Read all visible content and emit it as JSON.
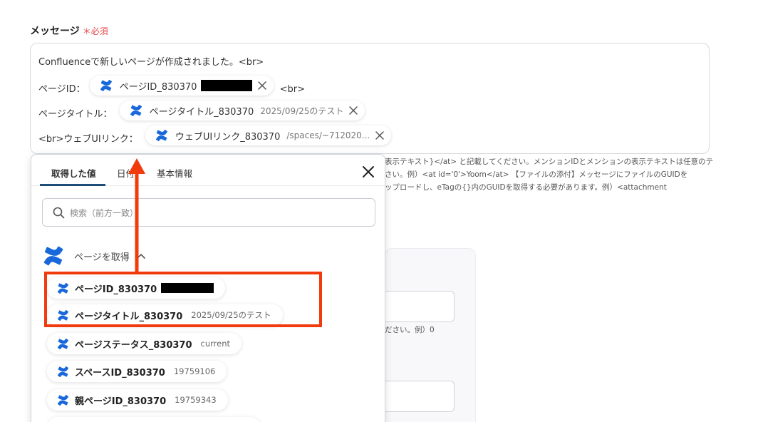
{
  "field": {
    "label": "メッセージ",
    "required_mark": "＊",
    "required_text": "必須"
  },
  "message": {
    "line1": "Confluenceで新しいページが作成されました。<br>",
    "line2_prefix": "ページID：",
    "line2_pill": "ページID_830370",
    "line2_suffix": "<br>",
    "line3_prefix": "ページタイトル：",
    "line3_pill": "ページタイトル_830370",
    "line3_pill_value": "2025/09/25のテスト",
    "line4_prefix": "<br>ウェブUIリンク：",
    "line4_pill": "ウェブUIリンク_830370",
    "line4_pill_value": "/spaces/~712020..."
  },
  "help_text": [
    "表示テキスト}</at> と記載してください。メンションIDとメンションの表示テキストは任意のテ",
    "さい。例）<at id='0'>Yoom</at>  【ファイルの添付】メッセージにファイルのGUIDを",
    "ップロードし、eTagの{}内のGUIDを取得する必要があります。例）<attachment"
  ],
  "bg_snippet": "ださい。例）0",
  "popup": {
    "tabs": [
      "取得した値",
      "日付",
      "基本情報"
    ],
    "active_tab": 0,
    "search_placeholder": "検索（前方一致）",
    "group_title": "ページを取得",
    "items": [
      {
        "name": "ページID_830370",
        "value": "",
        "redacted": true
      },
      {
        "name": "ページタイトル_830370",
        "value": "2025/09/25のテスト",
        "redacted": false
      },
      {
        "name": "ページステータス_830370",
        "value": "current",
        "redacted": false
      },
      {
        "name": "スペースID_830370",
        "value": "19759106",
        "redacted": false
      },
      {
        "name": "親ページID_830370",
        "value": "19759343",
        "redacted": false
      }
    ]
  },
  "colors": {
    "accent": "#f23b0c",
    "tab_underline": "#1c4d78",
    "confluence": "#1868db",
    "required": "#e5484d"
  }
}
